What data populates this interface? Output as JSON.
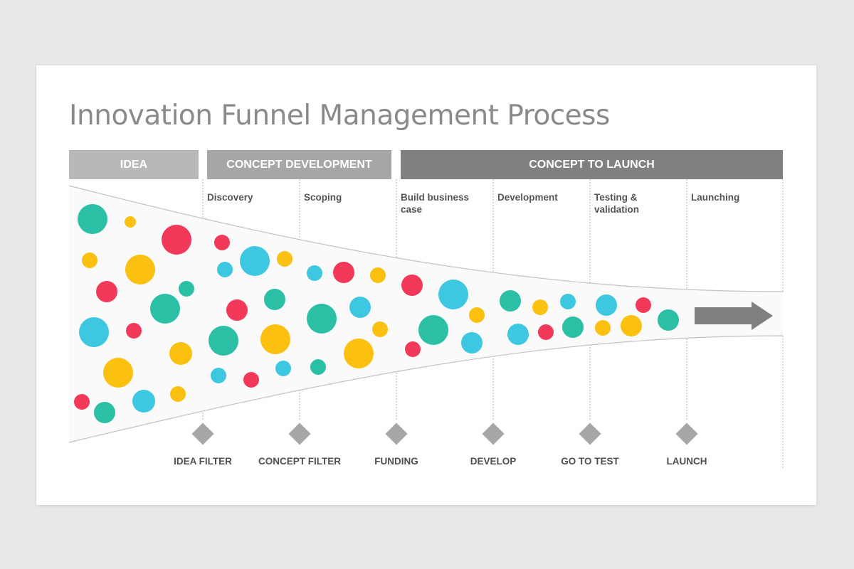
{
  "title": "Innovation Funnel Management Process",
  "stages": [
    {
      "label": "IDEA"
    },
    {
      "label": "CONCEPT DEVELOPMENT"
    },
    {
      "label": "CONCEPT TO LAUNCH"
    }
  ],
  "steps": [
    {
      "label": "Discovery"
    },
    {
      "label": "Scoping"
    },
    {
      "label": "Build business case"
    },
    {
      "label": "Development"
    },
    {
      "label": "Testing & validation"
    },
    {
      "label": "Launching"
    }
  ],
  "gates": [
    {
      "label": "IDEA FILTER"
    },
    {
      "label": "CONCEPT FILTER"
    },
    {
      "label": "FUNDING"
    },
    {
      "label": "DEVELOP"
    },
    {
      "label": "GO TO TEST"
    },
    {
      "label": "LAUNCH"
    }
  ],
  "colors": {
    "teal": "#2bbfa6",
    "yellow": "#fcc010",
    "red": "#f2395a",
    "blue": "#3ec7e0",
    "gate": "#a6a6a6",
    "arrow": "#7f7f7f"
  },
  "icons": {
    "gate": "diamond",
    "output": "arrow-right"
  }
}
